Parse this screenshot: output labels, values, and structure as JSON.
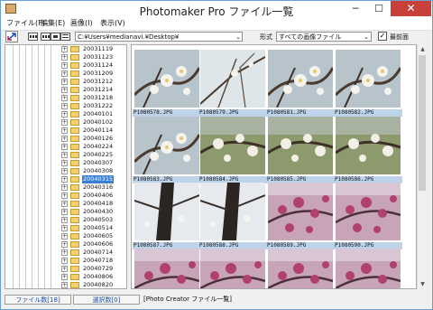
{
  "window": {
    "title": "Photomaker Pro ファイル一覧",
    "minimize": "─",
    "maximize": "☐",
    "close": "✕"
  },
  "menu": [
    "ファイル(F)",
    "編集(E)",
    "画像(I)",
    "表示(V)"
  ],
  "toolbar": {
    "path": "C:¥Users¥medianavi.¥Desktop¥",
    "format_label": "形式",
    "format_value": "すべての画像ファイル",
    "topmost_checked": true,
    "topmost_label": "最前面",
    "check_mark": "✓",
    "dropdown_arrow": "⌄"
  },
  "tree": {
    "expander": "+",
    "selected_index": 16,
    "items": [
      "20031119",
      "20031123",
      "20031124",
      "20031209",
      "20031212",
      "20031214",
      "20031218",
      "20031222",
      "20040101",
      "20040102",
      "20040114",
      "20040126",
      "20040224",
      "20040225",
      "20040307",
      "20040308",
      "20040315",
      "20040316",
      "20040406",
      "20040418",
      "20040430",
      "20040503",
      "20040514",
      "20040605",
      "20040606",
      "20040714",
      "20040718",
      "20040729",
      "20040806",
      "20040820"
    ]
  },
  "thumbnails": [
    {
      "name": "P1080578.JPG",
      "kind": "white-flowers"
    },
    {
      "name": "P1080579.JPG",
      "kind": "branches"
    },
    {
      "name": "P1080581.JPG",
      "kind": "white-flowers"
    },
    {
      "name": "P1080582.JPG",
      "kind": "white-flowers"
    },
    {
      "name": "P1080583.JPG",
      "kind": "white-flowers"
    },
    {
      "name": "P1080584.JPG",
      "kind": "green-blossom"
    },
    {
      "name": "P1080585.JPG",
      "kind": "green-blossom"
    },
    {
      "name": "P1080586.JPG",
      "kind": "green-blossom"
    },
    {
      "name": "P1080587.JPG",
      "kind": "trunk"
    },
    {
      "name": "P1080588.JPG",
      "kind": "trunk"
    },
    {
      "name": "P1080589.JPG",
      "kind": "pink-blossom"
    },
    {
      "name": "P1080590.JPG",
      "kind": "pink-blossom"
    },
    {
      "name": "",
      "kind": "pink-blossom"
    },
    {
      "name": "",
      "kind": "pink-blossom"
    },
    {
      "name": "",
      "kind": "pink-blossom"
    },
    {
      "name": "",
      "kind": "pink-blossom"
    }
  ],
  "status": {
    "file_count": "ファイル数[18]",
    "selected_count": "選択数[0]",
    "app_label": "[Photo Creator ファイル一覧]"
  },
  "icons": {
    "app": "app-icon",
    "expand": "expand-icon",
    "views": [
      "thumbnail-large-icon",
      "thumbnail-medium-icon",
      "thumbnail-small-icon",
      "list-view-icon"
    ]
  }
}
